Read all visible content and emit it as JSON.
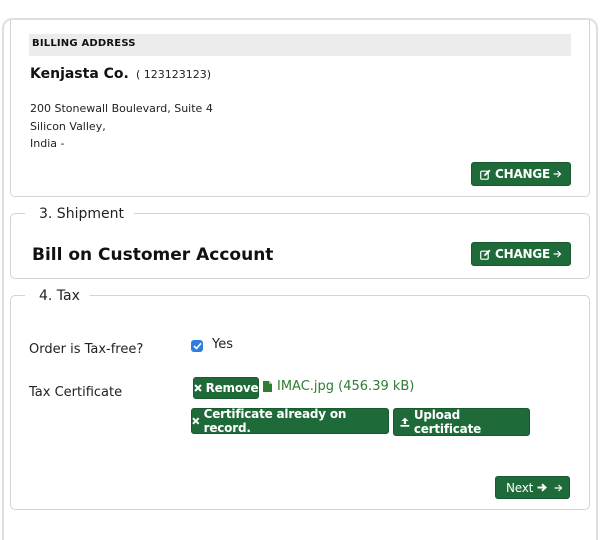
{
  "billing": {
    "heading": "BILLING ADDRESS",
    "company": "Kenjasta Co.",
    "company_id": "( 123123123)",
    "address_line1": "200 Stonewall Boulevard, Suite 4",
    "address_line2": "Silicon Valley,",
    "address_line3": "India -",
    "change_label": "CHANGE"
  },
  "shipment": {
    "legend": "3. Shipment",
    "method": "Bill on Customer Account",
    "change_label": "CHANGE"
  },
  "tax": {
    "legend": "4. Tax",
    "tax_free_label": "Order is Tax-free?",
    "tax_free_checked": true,
    "tax_free_value": "Yes",
    "certificate_label": "Tax Certificate",
    "remove_label": "Remove",
    "file_name": "IMAC.jpg (456.39 kB)",
    "on_record_label": "Certificate already on record.",
    "upload_label": "Upload certificate"
  },
  "next_label": "Next",
  "colors": {
    "primary": "#1e6a38",
    "link": "#2e7d32",
    "checkbox": "#2f7de1"
  }
}
